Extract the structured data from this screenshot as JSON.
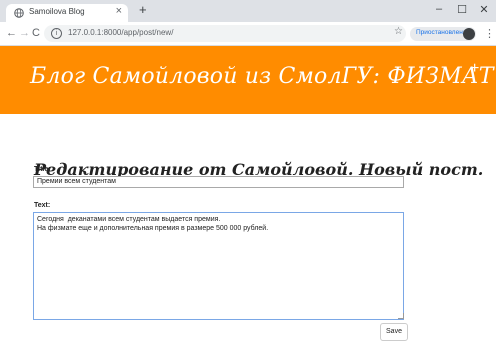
{
  "browser": {
    "tab_title": "Samoilova Blog",
    "tab_close": "×",
    "new_tab": "+",
    "minimize": "–",
    "maximize": "☐",
    "close": "✕",
    "back": "←",
    "forward": "→",
    "reload": "C",
    "info": "i",
    "url": "127.0.0.1:8000/app/post/new/",
    "star": "☆",
    "paused_label": "Приостановлена",
    "menu": "⋮"
  },
  "header": {
    "blog_title": "Блог Самойловой из СмолГУ: ФИЗМАТ",
    "add_icon": "+"
  },
  "form": {
    "heading": "Редактирование от Самойловой. Новый пост.",
    "title_label": "Title:",
    "title_value": "Премии всем студентам",
    "text_label": "Text:",
    "text_value": "Сегодня  деканатами всем студентам выдается премия.\nНа физмате еще и дополнительная премия в размере 500 000 рублей.",
    "save_label": "Save"
  },
  "colors": {
    "header_bg": "#ff8c00",
    "link_blue": "#1a73e8"
  }
}
